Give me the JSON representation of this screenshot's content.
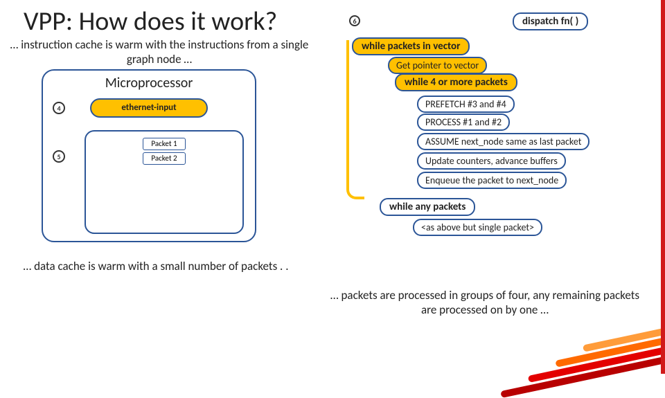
{
  "title": "VPP: How does it work?",
  "badges": {
    "six": "6",
    "four": "4",
    "five": "5"
  },
  "notes": {
    "icache": "… instruction cache is warm with the instructions from a single graph node …",
    "dcache": "… data cache is warm with a small number of packets . .",
    "groups": "… packets are processed in groups of four, any remaining packets are processed on by one …"
  },
  "micro": {
    "label": "Microprocessor",
    "eth": "ethernet-input",
    "packets": [
      "Packet 1",
      "Packet 2"
    ]
  },
  "flow": {
    "dispatch": "dispatch  fn( )",
    "while_vector": "while packets in vector",
    "get_ptr": "Get pointer to vector",
    "while_four": "while 4 or more packets",
    "prefetch": "PREFETCH #3 and #4",
    "process": "PROCESS #1 and #2",
    "assume": "ASSUME next_node same as last packet",
    "counters": "Update counters, advance buffers",
    "enqueue": "Enqueue the packet to next_node",
    "while_any": "while any packets",
    "single": "<as above but single packet>"
  }
}
